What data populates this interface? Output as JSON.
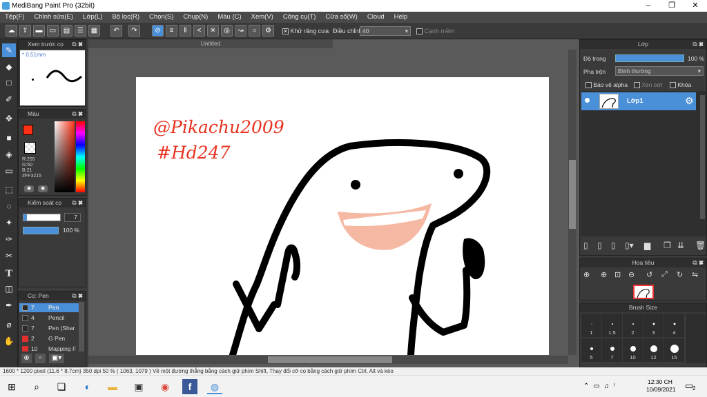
{
  "window": {
    "title": "MediBang Paint Pro (32bit)",
    "minimize": "–",
    "maximize": "❐",
    "close": "✕"
  },
  "menu": [
    "Tệp(F)",
    "Chỉnh sửa(E)",
    "Lớp(L)",
    "Bộ lọc(R)",
    "Chọn(S)",
    "Chụp(N)",
    "Màu (C)",
    "Xem(V)",
    "Công cụ(T)",
    "Cửa sổ(W)",
    "Cloud",
    "Help"
  ],
  "toolbar": {
    "antialias_label": "Khử răng cưa",
    "adjust_label": "Điều chỉnh",
    "adjust_value": "40",
    "edge_label": "Cạnh mềm"
  },
  "brush_preview": {
    "title": "Xem trước cọ",
    "size": "0.51mm"
  },
  "color_panel": {
    "title": "Màu",
    "r": "R:255",
    "g": "G:50",
    "b": "B:21",
    "hex": "#FF3215",
    "primary_color": "#ff3215"
  },
  "control_panel": {
    "title": "Kiểm soát cọ",
    "size_value": "7",
    "opacity_value": "100 %"
  },
  "brush_panel": {
    "title": "Cọ: Pen",
    "items": [
      {
        "size": "7",
        "name": "Pen",
        "color": "#2a2a2a",
        "selected": true
      },
      {
        "size": "4",
        "name": "Pencil",
        "color": "#2a2a2a"
      },
      {
        "size": "7",
        "name": "Pen (Shar",
        "color": "#2a2a2a"
      },
      {
        "size": "2",
        "name": "G Pen",
        "color": "#e03030"
      },
      {
        "size": "10",
        "name": "Mapping F",
        "color": "#e03030"
      }
    ]
  },
  "document": {
    "tab_title": "Untitled"
  },
  "canvas_drawing": {
    "signature": "@Pikachu2009",
    "tag": "#Hd247"
  },
  "layer_panel": {
    "title": "Lớp",
    "opacity_label": "Độ trong",
    "opacity_value": "100 %",
    "blend_label": "Pha trộn",
    "blend_value": "Bình thường",
    "protect_alpha": "Bảo vệ alpha",
    "clipping": "Xén bớt",
    "lock": "Khóa",
    "layers": [
      {
        "name": "Lớp1"
      }
    ]
  },
  "navigator_panel": {
    "title": "Hoa tiêu"
  },
  "brush_size_panel": {
    "title": "Brush Size",
    "sizes": [
      "1",
      "1.5",
      "2",
      "3",
      "4",
      "5",
      "7",
      "10",
      "12",
      "15"
    ]
  },
  "status": {
    "size": "1600 * 1200 pixel",
    "cm": "(11.6 * 8.7cm)",
    "dpi": "350 dpi",
    "zoom": "50 %",
    "coords": "( 1063, 1079 )",
    "hint": "Vẽ một đường thẳng bằng cách giữ phím Shift, Thay đổi cỡ cọ bằng cách giữ phím Ctrl, Alt và kéo"
  },
  "taskbar": {
    "time": "12:30 CH",
    "date": "10/09/2021",
    "notifications": "2"
  }
}
